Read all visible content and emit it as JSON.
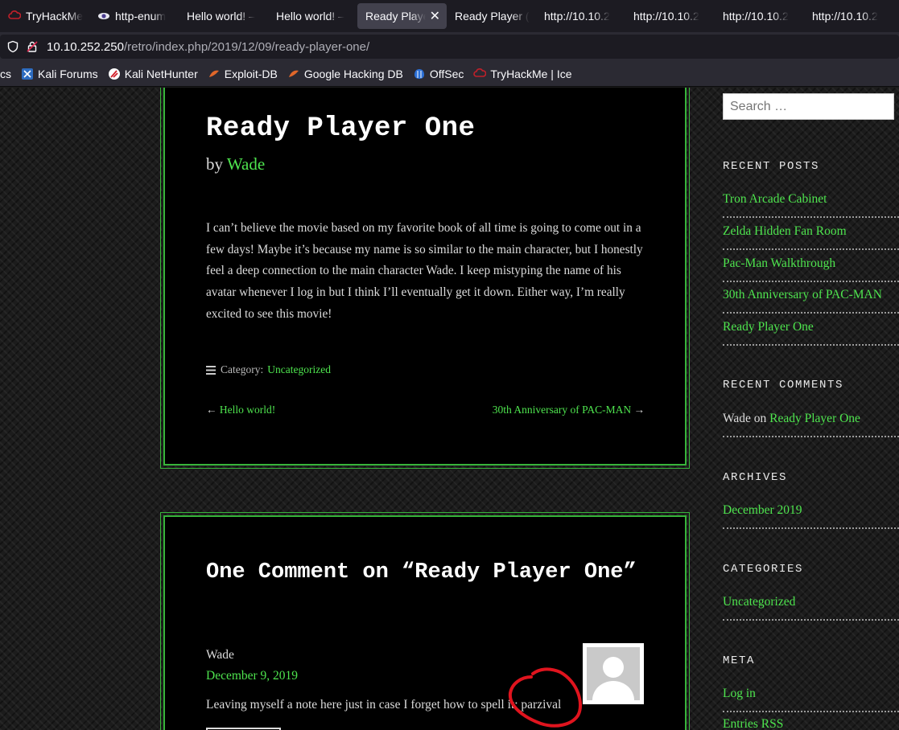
{
  "browser": {
    "tabs": [
      {
        "label": "TryHackMe",
        "icon": "tryhackme-icon",
        "active": false
      },
      {
        "label": "http-enum",
        "icon": "eye-icon",
        "active": false
      },
      {
        "label": "Hello world! –",
        "icon": "",
        "active": false
      },
      {
        "label": "Hello world! –",
        "icon": "",
        "active": false
      },
      {
        "label": "Ready Player",
        "icon": "",
        "active": true
      },
      {
        "label": "Ready Player (",
        "icon": "",
        "active": false
      },
      {
        "label": "http://10.10.2",
        "icon": "",
        "active": false
      },
      {
        "label": "http://10.10.2",
        "icon": "",
        "active": false
      },
      {
        "label": "http://10.10.2",
        "icon": "",
        "active": false
      },
      {
        "label": "http://10.10.2",
        "icon": "",
        "active": false
      }
    ],
    "url": {
      "host": "10.10.252.250",
      "path": "/retro/index.php/2019/12/09/ready-player-one/"
    },
    "bookmarks": [
      {
        "label": "cs",
        "icon": ""
      },
      {
        "label": "Kali Forums",
        "icon": "kali-forums-icon"
      },
      {
        "label": "Kali NetHunter",
        "icon": "kali-nethunter-icon"
      },
      {
        "label": "Exploit-DB",
        "icon": "exploit-db-icon"
      },
      {
        "label": "Google Hacking DB",
        "icon": "ghdb-icon"
      },
      {
        "label": "OffSec",
        "icon": "offsec-icon"
      },
      {
        "label": "TryHackMe | Ice",
        "icon": "tryhackme-icon"
      }
    ]
  },
  "post": {
    "title": "Ready Player One",
    "by": "by",
    "author": "Wade",
    "body": "I can’t believe the movie based on my favorite book of all time is going to come out in a few days! Maybe it’s because my name is so similar to the main character, but I honestly feel a deep connection to the main character Wade. I keep mistyping the name of his avatar whenever I log in but I think I’ll eventually get it down. Either way, I’m really excited to see this movie!",
    "category_label": "Category:",
    "category": "Uncategorized",
    "prev_link": "Hello world!",
    "next_link": "30th Anniversary of PAC-MAN"
  },
  "comments": {
    "title": "One Comment on “Ready Player One”",
    "items": [
      {
        "author": "Wade",
        "date": "December 9, 2019",
        "text": "Leaving myself a note here just in case I forget how to spell it: parzival"
      }
    ]
  },
  "sidebar": {
    "search_placeholder": "Search …",
    "recent_posts_title": "RECENT POSTS",
    "recent_posts": [
      "Tron Arcade Cabinet",
      "Zelda Hidden Fan Room",
      "Pac-Man Walkthrough",
      "30th Anniversary of PAC-MAN",
      "Ready Player One"
    ],
    "recent_comments_title": "RECENT COMMENTS",
    "recent_comment": {
      "author": "Wade",
      "on": "on",
      "post": "Ready Player One"
    },
    "archives_title": "ARCHIVES",
    "archives": [
      "December 2019"
    ],
    "categories_title": "CATEGORIES",
    "categories": [
      "Uncategorized"
    ],
    "meta_title": "META",
    "meta": [
      "Log in",
      "Entries RSS"
    ]
  },
  "colors": {
    "accent_green": "#4ee44e",
    "border_green": "#37b43a",
    "annotation_red": "#e0141e"
  }
}
